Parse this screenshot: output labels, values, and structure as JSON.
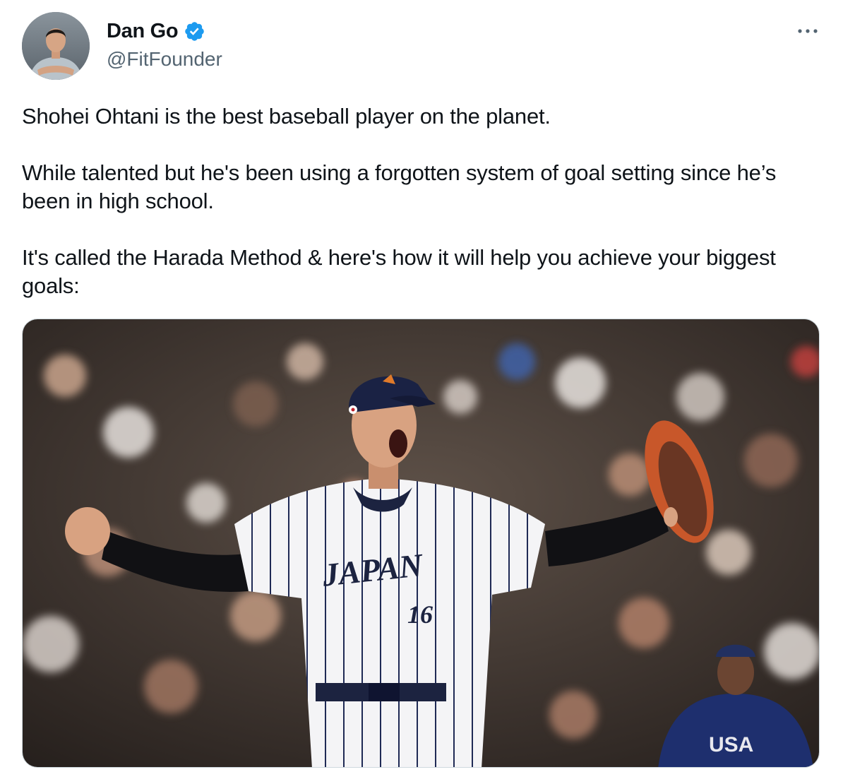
{
  "author": {
    "display_name": "Dan Go",
    "handle": "@FitFounder",
    "verified": true,
    "avatar_icon": "avatar-photo"
  },
  "menu_icon": "more-options-icon",
  "tweet": {
    "text": "Shohei Ohtani is the best baseball player on the planet.\n\nWhile talented but he's been using a forgotten system of goal setting since he’s been in high school.\n\nIt's called the Harada Method & here's how it will help you achieve your biggest goals:"
  },
  "media": {
    "jersey_text": "JAPAN",
    "jersey_number": "16",
    "opponent_jersey_text": "USA"
  },
  "colors": {
    "verified_blue": "#1d9bf0",
    "text_primary": "#0f1419",
    "text_secondary": "#536471",
    "border": "#cfd9de"
  }
}
